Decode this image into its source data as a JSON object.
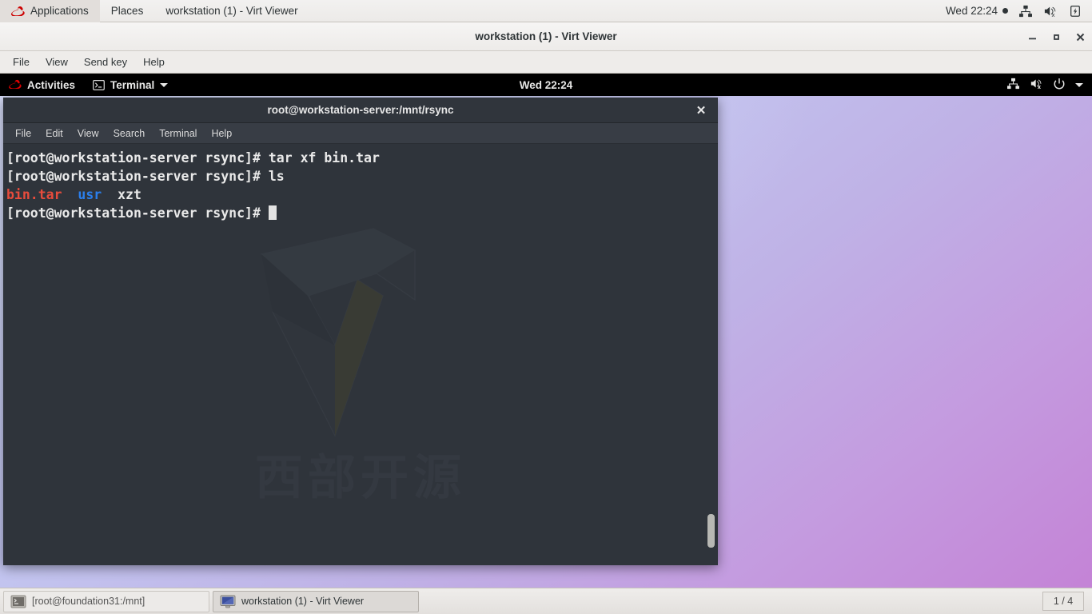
{
  "host_panel": {
    "applications_label": "Applications",
    "places_label": "Places",
    "window_title": "workstation (1) - Virt Viewer",
    "clock": "Wed 22:24",
    "icons": [
      "redhat-icon",
      "network-icon",
      "volume-muted-icon",
      "battery-icon"
    ]
  },
  "virt_viewer": {
    "title": "workstation (1) - Virt Viewer",
    "menu": [
      "File",
      "View",
      "Send key",
      "Help"
    ],
    "window_buttons": {
      "minimize": "—",
      "maximize": "□",
      "close": "✕"
    }
  },
  "guest_panel": {
    "activities_label": "Activities",
    "app_label": "Terminal",
    "clock": "Wed 22:24",
    "icons": [
      "network-icon",
      "volume-muted-icon",
      "power-icon",
      "chevron-down-icon"
    ]
  },
  "terminal": {
    "title": "root@workstation-server:/mnt/rsync",
    "close_label": "✕",
    "menu": [
      "File",
      "Edit",
      "View",
      "Search",
      "Terminal",
      "Help"
    ],
    "lines": [
      {
        "prompt": "[root@workstation-server rsync]# ",
        "command": "tar xf bin.tar"
      },
      {
        "prompt": "[root@workstation-server rsync]# ",
        "command": "ls"
      }
    ],
    "ls_output": [
      {
        "name": "bin.tar",
        "color": "red"
      },
      {
        "name": "usr",
        "color": "blue"
      },
      {
        "name": "xzt",
        "color": "white"
      }
    ],
    "final_prompt": "[root@workstation-server rsync]# ",
    "colors": {
      "background": "#2f343b",
      "foreground": "#e9e9e9",
      "archive_red": "#e74c3c",
      "directory_blue": "#2b7fec",
      "titlebar": "#30353c",
      "menubar": "#383d45"
    }
  },
  "watermark": {
    "text": "西部开源"
  },
  "taskbar": {
    "items": [
      {
        "label": "[root@foundation31:/mnt]",
        "icon": "terminal-icon",
        "active": false
      },
      {
        "label": "workstation (1) - Virt Viewer",
        "icon": "display-icon",
        "active": true
      }
    ],
    "workspace": "1 / 4"
  },
  "desktop": {
    "gradient_from": "#ccd4f5",
    "gradient_to": "#c483d6"
  }
}
